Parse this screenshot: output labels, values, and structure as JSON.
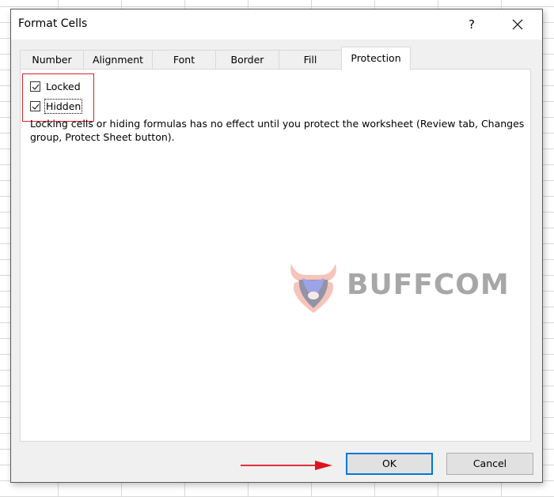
{
  "dialog": {
    "title": "Format Cells",
    "help_label": "?",
    "tabs": [
      {
        "label": "Number",
        "active": false
      },
      {
        "label": "Alignment",
        "active": false
      },
      {
        "label": "Font",
        "active": false
      },
      {
        "label": "Border",
        "active": false
      },
      {
        "label": "Fill",
        "active": false
      },
      {
        "label": "Protection",
        "active": true
      }
    ],
    "protection": {
      "locked": {
        "label": "Locked",
        "checked": true
      },
      "hidden": {
        "label": "Hidden",
        "checked": true
      },
      "note": "Locking cells or hiding formulas has no effect until you protect the worksheet (Review tab, Changes group, Protect Sheet button)."
    },
    "buttons": {
      "ok": "OK",
      "cancel": "Cancel"
    }
  },
  "watermark": {
    "text": "BUFFCOM"
  },
  "annotations": {
    "highlight_color": "#d9232d",
    "arrow_color": "#e0141e"
  }
}
